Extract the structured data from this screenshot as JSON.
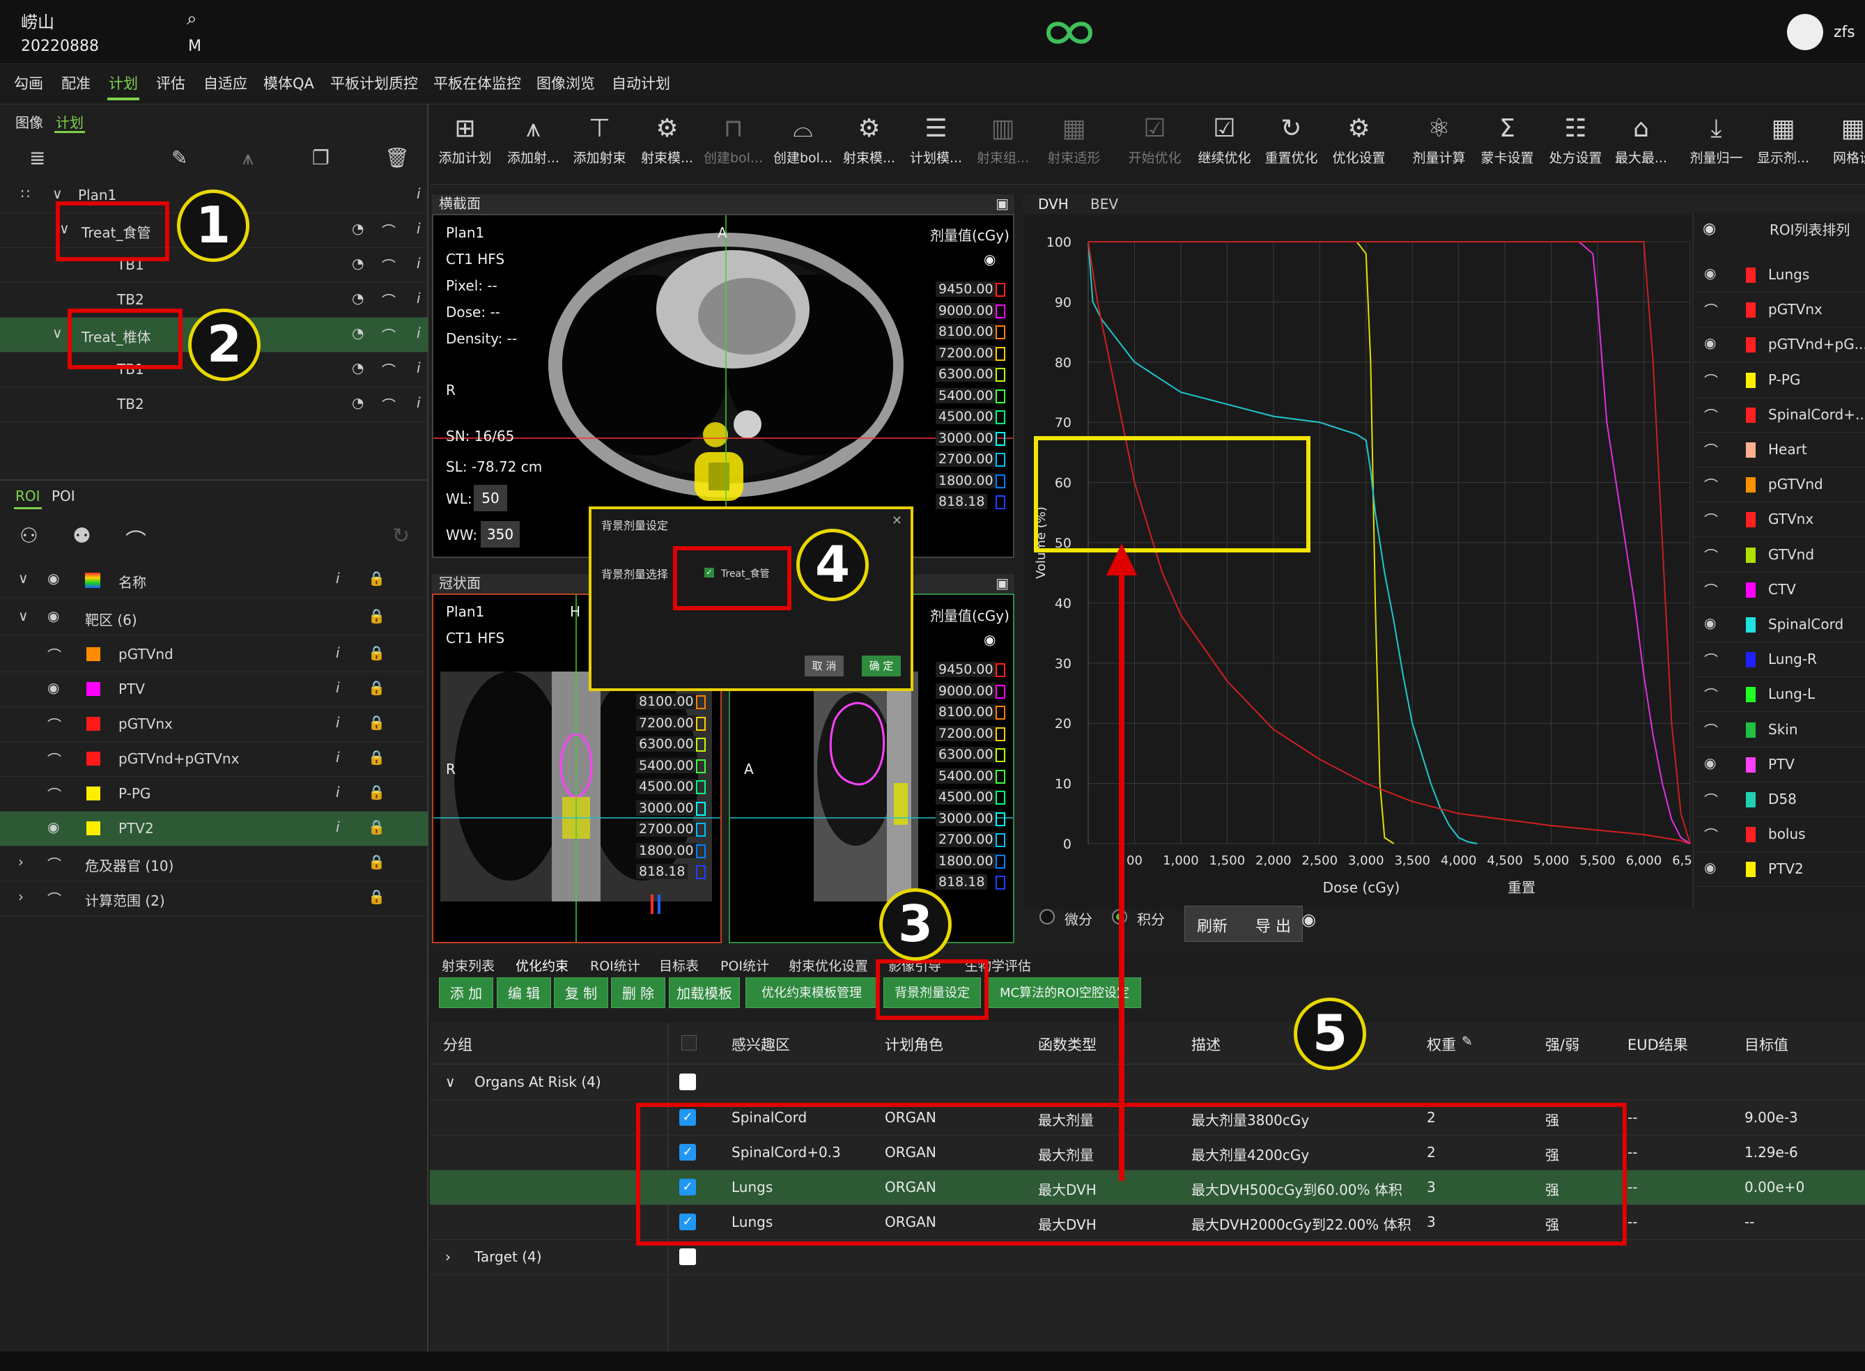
{
  "header": {
    "patient_name": "崂山",
    "patient_id": "20220888",
    "patient_sex": "M",
    "user": "zfs"
  },
  "menu": [
    "勾画",
    "配准",
    "计划",
    "评估",
    "自适应",
    "模体QA",
    "平板计划质控",
    "平板在体监控",
    "图像浏览",
    "自动计划"
  ],
  "menu_active_index": 2,
  "left_tabs": {
    "image": "图像",
    "plan": "计划"
  },
  "plan_tree": {
    "plan": "Plan1",
    "treat1": "Treat_食管",
    "tb1a": "TB1",
    "tb2a": "TB2",
    "treat2": "Treat_椎体",
    "tb1b": "TB1",
    "tb2b": "TB2"
  },
  "roi_tabs": {
    "roi": "ROI",
    "poi": "POI"
  },
  "roi_tree": {
    "header": "名称",
    "target_group": "靶区 (6)",
    "oar_group": "危及器官 (10)",
    "calc_group": "计算范围 (2)",
    "items": [
      {
        "name": "pGTVnd",
        "color": "#ff8c00"
      },
      {
        "name": "PTV",
        "color": "#ff00ff"
      },
      {
        "name": "pGTVnx",
        "color": "#ff1a1a"
      },
      {
        "name": "pGTVnd+pGTVnx",
        "color": "#ff1a1a"
      },
      {
        "name": "P-PG",
        "color": "#ffee00"
      },
      {
        "name": "PTV2",
        "color": "#ffee00"
      }
    ]
  },
  "toolbar": [
    {
      "label": "添加计划",
      "icon": "⊞"
    },
    {
      "label": "添加射...",
      "icon": "⩚"
    },
    {
      "label": "添加射束",
      "icon": "⊤"
    },
    {
      "label": "射束模...",
      "icon": "⚙"
    },
    {
      "label": "创建bol...",
      "icon": "⊓",
      "disabled": true
    },
    {
      "label": "创建bol...",
      "icon": "⌓"
    },
    {
      "label": "射束模...",
      "icon": "⚙"
    },
    {
      "label": "计划模...",
      "icon": "☰"
    },
    {
      "label": "射束组...",
      "icon": "▥",
      "disabled": true
    },
    {
      "label": "射束适形",
      "icon": "▦",
      "disabled": true
    },
    {
      "label": "开始优化",
      "icon": "☑",
      "disabled": true
    },
    {
      "label": "继续优化",
      "icon": "☑"
    },
    {
      "label": "重置优化",
      "icon": "↻"
    },
    {
      "label": "优化设置",
      "icon": "⚙"
    },
    {
      "label": "剂量计算",
      "icon": "⚛"
    },
    {
      "label": "蒙卡设置",
      "icon": "Σ"
    },
    {
      "label": "处方设置",
      "icon": "☷"
    },
    {
      "label": "最大最...",
      "icon": "⌂"
    },
    {
      "label": "剂量归一",
      "icon": "⤓"
    },
    {
      "label": "显示剂...",
      "icon": "▦"
    },
    {
      "label": "网格设",
      "icon": "▦"
    }
  ],
  "axial": {
    "title": "横截面",
    "plan": "Plan1",
    "ct": "CT1 HFS",
    "pixel": "Pixel:  --",
    "dose": "Dose:  --",
    "density": "Density:  --",
    "sn": "SN: 16/65",
    "sl": "SL: -78.72 cm",
    "wl_label": "WL:",
    "wl": "50",
    "ww_label": "WW:",
    "ww": "350",
    "orient_r": "R",
    "orient_a": "A",
    "dose_header": "剂量值(cGy)"
  },
  "coronal": {
    "title": "冠状面",
    "plan": "Plan1",
    "ct": "CT1 HFS",
    "orient_r": "R",
    "orient_h": "H",
    "orient_a": "A",
    "dose_header": "剂量值(cGy)"
  },
  "dose_levels": [
    {
      "v": "9450.00",
      "c": "#ff2020"
    },
    {
      "v": "9000.00",
      "c": "#ff00ff"
    },
    {
      "v": "8100.00",
      "c": "#ff8000"
    },
    {
      "v": "7200.00",
      "c": "#ffd000"
    },
    {
      "v": "6300.00",
      "c": "#c0ff00"
    },
    {
      "v": "5400.00",
      "c": "#40ff40"
    },
    {
      "v": "4500.00",
      "c": "#00ff80"
    },
    {
      "v": "3000.00",
      "c": "#00ffff"
    },
    {
      "v": "2700.00",
      "c": "#00c0ff"
    },
    {
      "v": "1800.00",
      "c": "#0080ff"
    },
    {
      "v": "818.18",
      "c": "#2040ff"
    }
  ],
  "dialog": {
    "title": "背景剂量设定",
    "label": "背景剂量选择",
    "option": "Treat_食管",
    "cancel": "取 消",
    "ok": "确 定"
  },
  "dvh_tabs": {
    "dvh": "DVH",
    "bev": "BEV"
  },
  "chart_data": {
    "type": "line",
    "xlabel": "Dose (cGy)",
    "ylabel": "Volume (%)",
    "xlim": [
      0,
      6500
    ],
    "ylim": [
      0,
      100
    ],
    "xticks": [
      500,
      1000,
      1500,
      2000,
      2500,
      3000,
      3500,
      4000,
      4500,
      5000,
      5500,
      6000,
      6500
    ],
    "xtick_labels": [
      "00",
      "1,000",
      "1,500",
      "2,000",
      "2,500",
      "3,000",
      "3,500",
      "4,000",
      "4,500",
      "5,000",
      "5,500",
      "6,000",
      "6,500"
    ],
    "yticks": [
      0,
      10,
      20,
      30,
      40,
      50,
      60,
      70,
      80,
      90,
      100
    ],
    "grid": true,
    "extra_label": "重置",
    "series": [
      {
        "color": "#e0e000",
        "x": [
          0,
          2900,
          3000,
          3050,
          3100,
          3150,
          3200,
          3300
        ],
        "y": [
          100,
          100,
          98,
          80,
          40,
          10,
          1,
          0
        ]
      },
      {
        "color": "#20c8d0",
        "x": [
          0,
          50,
          150,
          300,
          500,
          800,
          1000,
          1500,
          2000,
          2500,
          2900,
          3000,
          3050,
          3100,
          3200,
          3300,
          3400,
          3500,
          3600,
          3700,
          3800,
          3900,
          4000,
          4100,
          4200
        ],
        "y": [
          100,
          90,
          87,
          84,
          80,
          77,
          75,
          73,
          71,
          70,
          68,
          67,
          62,
          55,
          45,
          37,
          28,
          20,
          15,
          10,
          6,
          3,
          1,
          0.3,
          0
        ]
      },
      {
        "color": "#d02020",
        "x": [
          0,
          100,
          300,
          500,
          800,
          1000,
          1500,
          2000,
          2500,
          3000,
          3500,
          4000,
          5000,
          6000,
          6400,
          6500
        ],
        "y": [
          100,
          90,
          75,
          60,
          45,
          38,
          27,
          19,
          14,
          10,
          7,
          5,
          3,
          1.5,
          0.5,
          0
        ]
      },
      {
        "color": "#e030e0",
        "x": [
          0,
          5300,
          5450,
          5500,
          5550,
          5600,
          5700,
          5800,
          5900,
          6000,
          6100,
          6200,
          6300,
          6400,
          6500
        ],
        "y": [
          100,
          100,
          98,
          90,
          80,
          70,
          60,
          50,
          40,
          28,
          18,
          10,
          4,
          1,
          0
        ]
      },
      {
        "color": "#c82020",
        "x": [
          0,
          6000,
          6100,
          6200,
          6300,
          6400,
          6500
        ],
        "y": [
          100,
          100,
          80,
          50,
          20,
          5,
          0
        ]
      }
    ]
  },
  "dvh_footer": {
    "diff": "微分",
    "integral": "积分",
    "refresh": "刷新",
    "export": "导 出"
  },
  "roi_list": {
    "header": "ROI列表排列",
    "items": [
      {
        "name": "Lungs",
        "color": "#ff2020"
      },
      {
        "name": "pGTVnx",
        "color": "#ff2020"
      },
      {
        "name": "pGTVnd+pG...",
        "color": "#ff2020"
      },
      {
        "name": "P-PG",
        "color": "#ffee00"
      },
      {
        "name": "SpinalCord+...",
        "color": "#ff2020"
      },
      {
        "name": "Heart",
        "color": "#ffb090"
      },
      {
        "name": "pGTVnd",
        "color": "#ff9000"
      },
      {
        "name": "GTVnx",
        "color": "#ff2020"
      },
      {
        "name": "GTVnd",
        "color": "#b0e000"
      },
      {
        "name": "CTV",
        "color": "#ff00ff"
      },
      {
        "name": "SpinalCord",
        "color": "#20e0e0"
      },
      {
        "name": "Lung-R",
        "color": "#2020ff"
      },
      {
        "name": "Lung-L",
        "color": "#20ff20"
      },
      {
        "name": "Skin",
        "color": "#20c040"
      },
      {
        "name": "PTV",
        "color": "#ff40ff"
      },
      {
        "name": "D58",
        "color": "#20d0b0"
      },
      {
        "name": "bolus",
        "color": "#ff2020"
      },
      {
        "name": "PTV2",
        "color": "#ffee00"
      }
    ]
  },
  "bottom_tabs": [
    "射束列表",
    "优化约束",
    "ROI统计",
    "目标表",
    "POI统计",
    "射束优化设置",
    "影像引导",
    "生物学评估"
  ],
  "bottom_buttons": [
    "添 加",
    "编 辑",
    "复 制",
    "删 除",
    "加载模板",
    "优化约束模板管理",
    "背景剂量设定",
    "MC算法的ROI空腔设定"
  ],
  "table": {
    "headers": [
      "分组",
      "感兴趣区",
      "计划角色",
      "函数类型",
      "描述",
      "权重",
      "强/弱",
      "EUD结果",
      "目标值"
    ],
    "group_oar": "Organs At Risk (4)",
    "group_target": "Target (4)",
    "rows": [
      {
        "roi": "SpinalCord",
        "role": "ORGAN",
        "func": "最大剂量",
        "desc": "最大剂量3800cGy",
        "weight": "2",
        "strength": "强",
        "eud": "--",
        "target": "9.00e-3"
      },
      {
        "roi": "SpinalCord+0.3",
        "role": "ORGAN",
        "func": "最大剂量",
        "desc": "最大剂量4200cGy",
        "weight": "2",
        "strength": "强",
        "eud": "--",
        "target": "1.29e-6"
      },
      {
        "roi": "Lungs",
        "role": "ORGAN",
        "func": "最大DVH",
        "desc": "最大DVH500cGy到60.00% 体积",
        "weight": "3",
        "strength": "强",
        "eud": "--",
        "target": "0.00e+0"
      },
      {
        "roi": "Lungs",
        "role": "ORGAN",
        "func": "最大DVH",
        "desc": "最大DVH2000cGy到22.00% 体积",
        "weight": "3",
        "strength": "强",
        "eud": "--",
        "target": "--"
      }
    ]
  },
  "annotations": [
    "1",
    "2",
    "3",
    "4",
    "5"
  ]
}
